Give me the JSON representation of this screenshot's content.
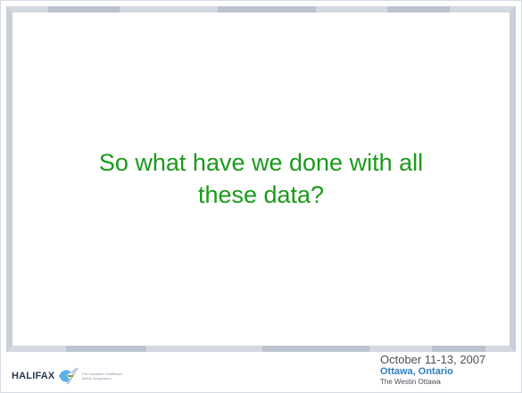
{
  "slide": {
    "title_line1": "So what have we done with all",
    "title_line2": "these data?"
  },
  "footer": {
    "logo_text": "HALIFAX",
    "logo_tagline_line1": "The Canadian Healthcare",
    "logo_tagline_line2": "Safety Symposium",
    "event_date": "October 11-13, 2007",
    "event_city": "Ottawa, Ontario",
    "event_venue": "The Westin Ottawa"
  },
  "colors": {
    "title": "#1a9a1a",
    "frame": "#c9ced8",
    "city": "#2f7ec0"
  },
  "icons": {
    "logo": "halifax-7-logo-icon"
  }
}
